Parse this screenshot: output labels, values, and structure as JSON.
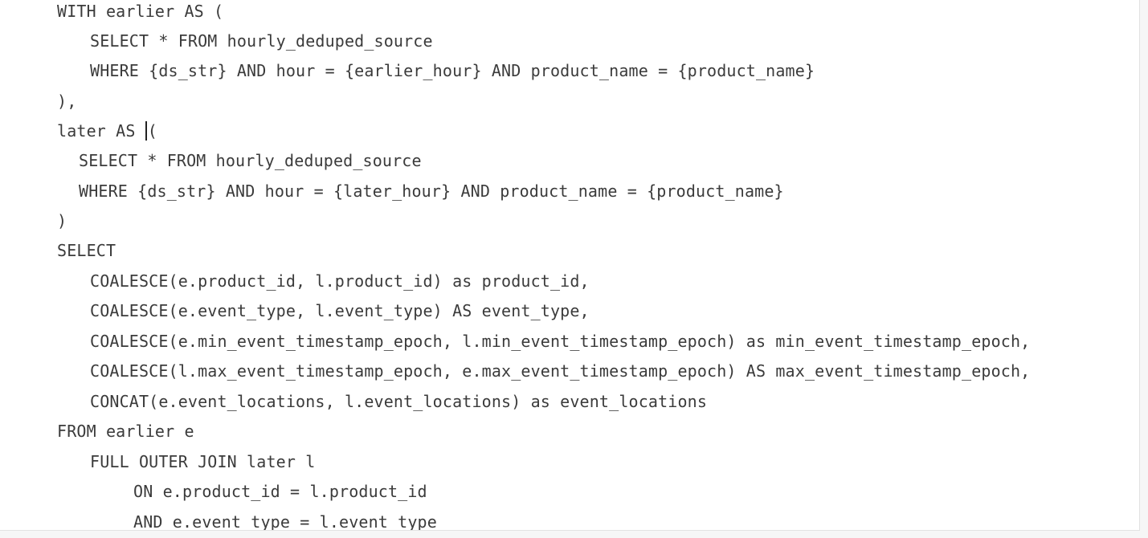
{
  "editor": {
    "lines": [
      "WITH earlier AS (",
      "SELECT * FROM hourly_deduped_source",
      "WHERE {ds_str} AND hour = {earlier_hour} AND product_name = {product_name}",
      "),",
      "later AS ",
      "(",
      "SELECT * FROM hourly_deduped_source",
      "WHERE {ds_str} AND hour = {later_hour} AND product_name = {product_name}",
      ")",
      "SELECT",
      "COALESCE(e.product_id, l.product_id) as product_id,",
      "COALESCE(e.event_type, l.event_type) AS event_type,",
      "COALESCE(e.min_event_timestamp_epoch, l.min_event_timestamp_epoch) as min_event_timestamp_epoch,",
      "COALESCE(l.max_event_timestamp_epoch, e.max_event_timestamp_epoch) AS max_event_timestamp_epoch,",
      "CONCAT(e.event_locations, l.event_locations) as event_locations",
      "FROM earlier e",
      "FULL OUTER JOIN later l",
      "ON e.product_id = l.product_id",
      "AND e.event_type = l.event_type"
    ]
  }
}
